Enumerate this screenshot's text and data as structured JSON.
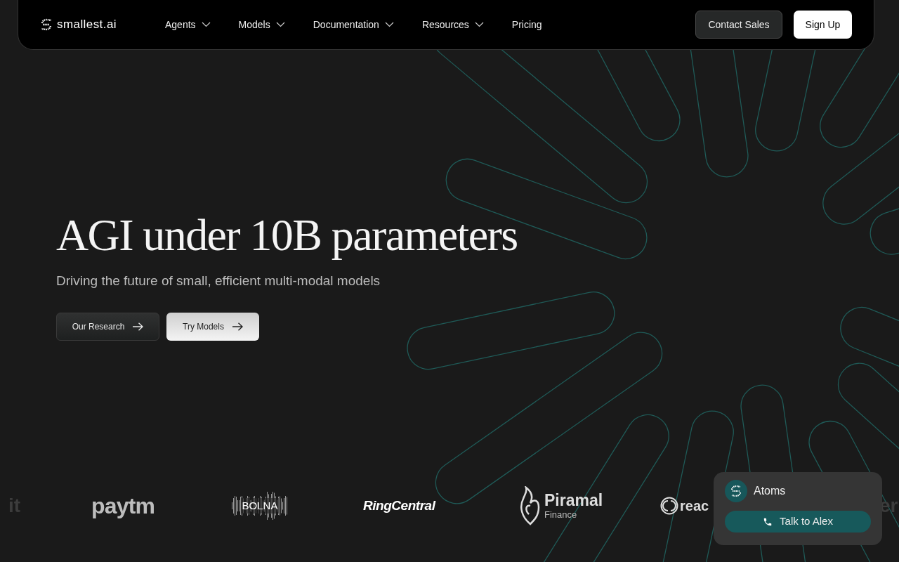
{
  "nav": {
    "brand": "smallest.ai",
    "items": [
      {
        "label": "Agents",
        "dropdown": true
      },
      {
        "label": "Models",
        "dropdown": true
      },
      {
        "label": "Documentation",
        "dropdown": true
      },
      {
        "label": "Resources",
        "dropdown": true
      },
      {
        "label": "Pricing",
        "dropdown": false
      }
    ],
    "buttons": [
      {
        "label": "Contact Sales",
        "kind": "secondary"
      },
      {
        "label": "Sign Up",
        "kind": "primary"
      }
    ]
  },
  "hero": {
    "title": "AGI under 10B parameters",
    "subtitle": "Driving the future of small, efficient multi-modal models",
    "buttons": [
      {
        "label": "Our Research",
        "kind": "dark"
      },
      {
        "label": "Try Models",
        "kind": "light"
      }
    ]
  },
  "logos": [
    {
      "text": "it",
      "kind": "faded"
    },
    {
      "text": "paytm",
      "kind": "bold"
    },
    {
      "text": "BOLNA",
      "kind": "waveform"
    },
    {
      "text": "RingCentral",
      "kind": "italic"
    },
    {
      "text": "Piramal",
      "sub": "Finance",
      "kind": "flame"
    },
    {
      "text": "reac",
      "kind": "ring"
    },
    {
      "text": "er",
      "kind": "faded"
    }
  ],
  "widget": {
    "title": "Atoms",
    "button": "Talk to Alex"
  }
}
